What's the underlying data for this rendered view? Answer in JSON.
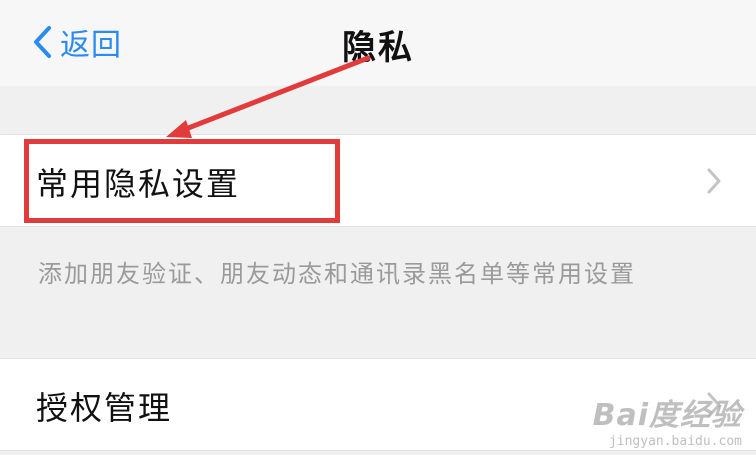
{
  "navbar": {
    "back_label": "返回",
    "title": "隐私"
  },
  "rows": [
    {
      "label": "常用隐私设置",
      "description": "添加朋友验证、朋友动态和通讯录黑名单等常用设置"
    },
    {
      "label": "授权管理"
    }
  ],
  "icons": {
    "back": "chevron-left-icon",
    "disclosure": "chevron-right-icon"
  },
  "colors": {
    "accent": "#2a8cf0",
    "annotation": "#e23b3b",
    "background": "#f0f0f0"
  },
  "watermark": {
    "brand": "Bai度经验",
    "sub": "jingyan.baidu.com"
  }
}
